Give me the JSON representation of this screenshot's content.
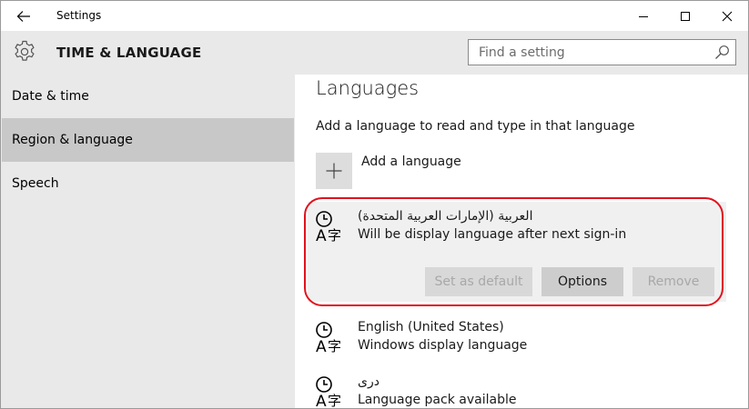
{
  "window": {
    "title": "Settings"
  },
  "header": {
    "section_title": "TIME & LANGUAGE",
    "search_placeholder": "Find a setting"
  },
  "sidebar": {
    "items": [
      {
        "label": "Date & time",
        "active": false
      },
      {
        "label": "Region & language",
        "active": true
      },
      {
        "label": "Speech",
        "active": false
      }
    ]
  },
  "main": {
    "title": "Languages",
    "subtitle": "Add a language to read and type in that language",
    "add_language_label": "Add a language",
    "languages": [
      {
        "name": "العربية (الإمارات العربية المتحدة)",
        "status": "Will be display language after next sign-in",
        "selected": true,
        "actions": {
          "set_default": "Set as default",
          "options": "Options",
          "remove": "Remove"
        }
      },
      {
        "name": "English (United States)",
        "status": "Windows display language",
        "selected": false
      },
      {
        "name": "درى",
        "status": "Language pack available",
        "selected": false
      }
    ]
  },
  "icons": {
    "back": "back-arrow-icon",
    "minimize": "minimize-icon",
    "maximize": "maximize-icon",
    "close": "close-icon",
    "settings": "gear-icon",
    "search": "search-icon",
    "add": "plus-icon",
    "language": "language-icon"
  },
  "colors": {
    "header_bg": "#e9e9e9",
    "sidebar_active": "#c8c8c8",
    "selected_item_bg": "#f0f0f0",
    "annotation_red": "#e0131e"
  }
}
